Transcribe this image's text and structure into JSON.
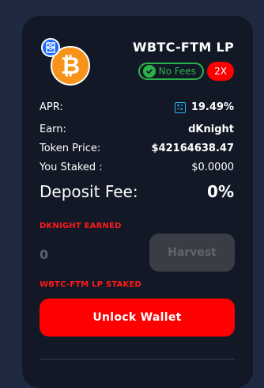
{
  "farm": {
    "title": "WBTC-FTM LP",
    "token_icon": "bitcoin-icon",
    "quote_icon": "fantom-icon",
    "badges": {
      "no_fees": "No Fees",
      "multiplier": "2X"
    },
    "stats": {
      "apr_label": "APR:",
      "apr_value": "19.49%",
      "earn_label": "Earn:",
      "earn_value": "dKnight",
      "token_price_label": "Token Price:",
      "token_price_value": "$42164638.47",
      "you_staked_label": "You Staked :",
      "you_staked_value": "$0.0000",
      "deposit_fee_label": "Deposit Fee:",
      "deposit_fee_value": "0%"
    },
    "earned": {
      "label": "DKNIGHT EARNED",
      "value": "0",
      "harvest_label": "Harvest"
    },
    "staked": {
      "label": "WBTC-FTM LP STAKED",
      "unlock_label": "Unlock Wallet"
    }
  },
  "colors": {
    "background": "#1f2a40",
    "card": "#121826",
    "accent_red": "#ff0000",
    "success_green": "#2bb34a",
    "bitcoin_orange": "#f7931a",
    "fantom_blue": "#1969ff",
    "calculator_blue": "#29b6f6"
  }
}
